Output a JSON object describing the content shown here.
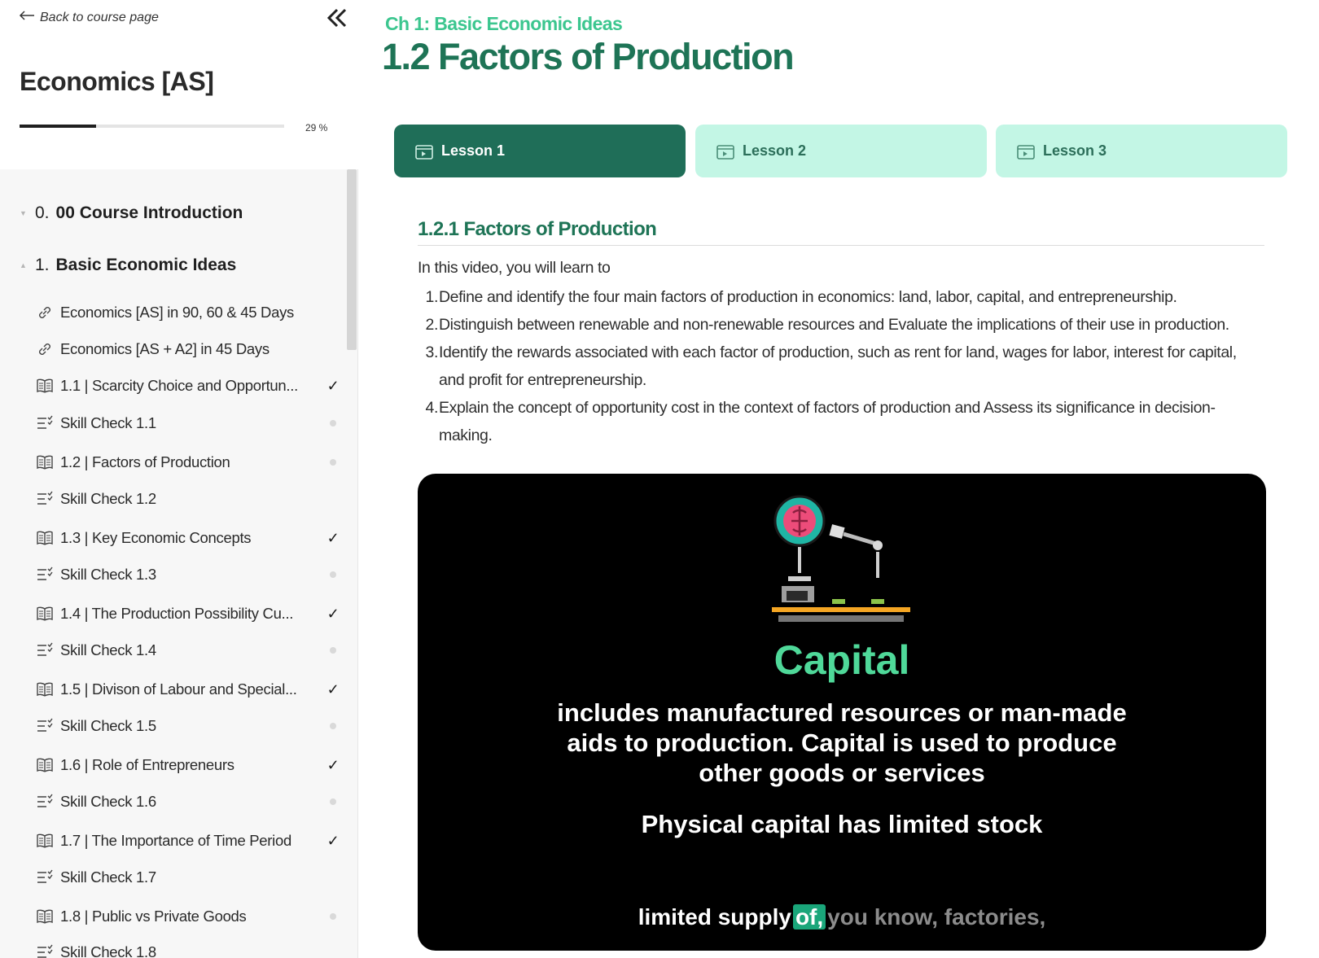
{
  "sidebar": {
    "back_label": "Back to course page",
    "course_title": "Economics [AS]",
    "progress_label": "29 %",
    "progress_value": 0.29,
    "chapters": [
      {
        "number": "0.",
        "title": "00 Course Introduction",
        "expanded": false
      },
      {
        "number": "1.",
        "title": "Basic Economic Ideas",
        "expanded": true
      }
    ],
    "items": [
      {
        "type": "link",
        "label": "Economics [AS] in 90, 60 & 45 Days",
        "status": "none"
      },
      {
        "type": "link",
        "label": "Economics [AS + A2] in 45 Days",
        "status": "none"
      },
      {
        "type": "lesson",
        "label": "1.1 | Scarcity Choice and Opportun...",
        "status": "complete"
      },
      {
        "type": "quiz",
        "label": "Skill Check 1.1",
        "status": "incomplete"
      },
      {
        "type": "lesson",
        "label": "1.2 | Factors of Production",
        "status": "incomplete"
      },
      {
        "type": "quiz",
        "label": "Skill Check 1.2",
        "status": "none"
      },
      {
        "type": "lesson",
        "label": "1.3 | Key Economic Concepts",
        "status": "complete"
      },
      {
        "type": "quiz",
        "label": "Skill Check 1.3",
        "status": "incomplete"
      },
      {
        "type": "lesson",
        "label": "1.4 | The Production Possibility Cu...",
        "status": "complete"
      },
      {
        "type": "quiz",
        "label": "Skill Check 1.4",
        "status": "incomplete"
      },
      {
        "type": "lesson",
        "label": "1.5 | Divison of Labour and Special...",
        "status": "complete"
      },
      {
        "type": "quiz",
        "label": "Skill Check 1.5",
        "status": "incomplete"
      },
      {
        "type": "lesson",
        "label": "1.6 | Role of Entrepreneurs",
        "status": "complete"
      },
      {
        "type": "quiz",
        "label": "Skill Check 1.6",
        "status": "incomplete"
      },
      {
        "type": "lesson",
        "label": "1.7 | The Importance of Time Period",
        "status": "complete"
      },
      {
        "type": "quiz",
        "label": "Skill Check 1.7",
        "status": "none"
      },
      {
        "type": "lesson",
        "label": "1.8 | Public vs Private Goods",
        "status": "incomplete"
      },
      {
        "type": "quiz",
        "label": "Skill Check 1.8",
        "status": "none"
      }
    ],
    "check_glyph": "✓"
  },
  "main": {
    "breadcrumb": "Ch 1:  Basic Economic Ideas",
    "title": "1.2  Factors of Production",
    "tabs": [
      {
        "label": "Lesson 1",
        "active": true
      },
      {
        "label": "Lesson 2",
        "active": false
      },
      {
        "label": "Lesson 3",
        "active": false
      }
    ],
    "section_title": "1.2.1 Factors of Production",
    "intro": "In this video, you will learn to",
    "objectives": [
      {
        "n": "1.",
        "text": "Define and identify the four main factors of production in economics: land, labor, capital, and entrepreneurship."
      },
      {
        "n": "2.",
        "text": "Distinguish between renewable and non-renewable resources and Evaluate the implications of their use in production."
      },
      {
        "n": "3.",
        "text": "Identify the rewards associated with each factor of production, such as rent for land, wages for labor, interest for capital, and profit for entrepreneurship."
      },
      {
        "n": "4.",
        "text": "Explain the concept of opportunity cost in the context of factors of production and Assess its significance in decision-making."
      }
    ],
    "video": {
      "heading": "Capital",
      "body": "includes manufactured resources or man-made aids to production. Capital is used to produce other goods or services",
      "note": "Physical capital has limited stock",
      "caption_spoken": "limited supply",
      "caption_current": "of,",
      "caption_upcoming": "you know, factories,"
    }
  },
  "colors": {
    "brand_dark": "#1e7456",
    "brand_light": "#3cc68f",
    "tab_inactive_bg": "#c3f6e5",
    "video_heading": "#4fd899"
  }
}
